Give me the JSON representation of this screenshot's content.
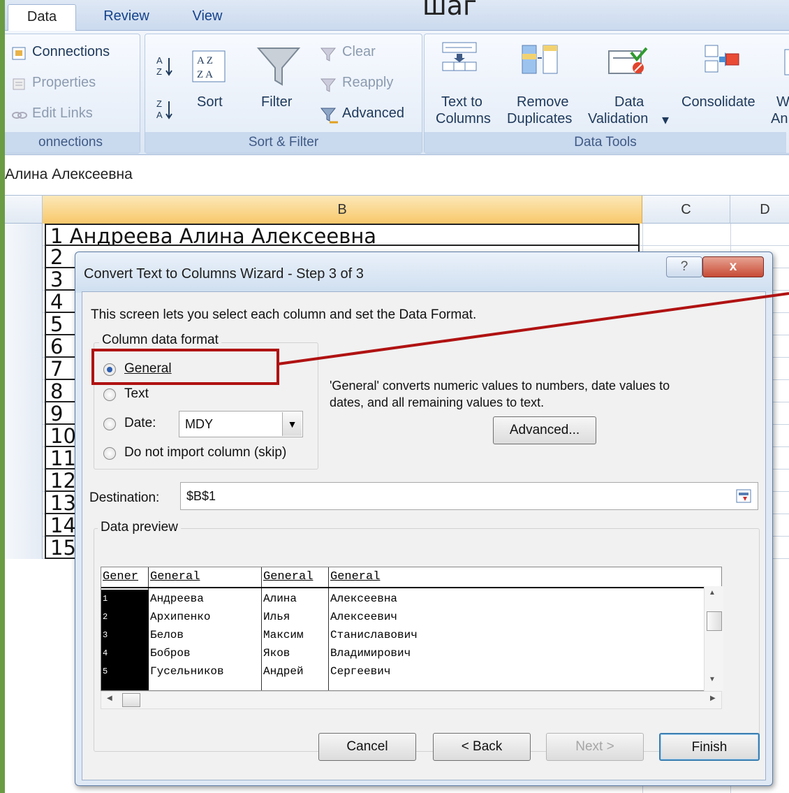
{
  "slide": {
    "title_fragment": "шаг"
  },
  "tabs": [
    {
      "label": "Data",
      "active": true
    },
    {
      "label": "Review",
      "active": false
    },
    {
      "label": "View",
      "active": false
    }
  ],
  "ribbon": {
    "connections": {
      "items": [
        "Connections",
        "Properties",
        "Edit Links"
      ],
      "label": "onnections"
    },
    "sort_filter": {
      "sort_label": "Sort",
      "filter_label": "Filter",
      "clear_label": "Clear",
      "reapply_label": "Reapply",
      "advanced_label": "Advanced",
      "label": "Sort & Filter"
    },
    "data_tools": {
      "text_to_columns": [
        "Text to",
        "Columns"
      ],
      "remove_duplicates": [
        "Remove",
        "Duplicates"
      ],
      "data_validation": [
        "Data",
        "Validation"
      ],
      "consolidate": "Consolidate",
      "whatif": [
        "W",
        "An"
      ],
      "label": "Data Tools"
    }
  },
  "formula_bar": {
    "value": "Алина Алексеевна"
  },
  "grid": {
    "columns": [
      "B",
      "C",
      "D"
    ],
    "first_row_text": "1 Андреева Алина Алексеевна",
    "row_prefixes": [
      "2 ",
      "3 ",
      "4 ",
      "5 ",
      "6 ",
      "7 ",
      "8 ",
      "9 ",
      "10",
      "11",
      "12",
      "13",
      "14",
      "15"
    ]
  },
  "dialog": {
    "title": "Convert Text to Columns Wizard - Step 3 of 3",
    "help": "?",
    "close": "x",
    "intro": "This screen lets you select each column and set the Data Format.",
    "format_legend": "Column data format",
    "options": [
      {
        "label": "General",
        "selected": true
      },
      {
        "label": "Text",
        "selected": false
      },
      {
        "label": "Date:",
        "selected": false
      },
      {
        "label": "Do not import column (skip)",
        "selected": false
      }
    ],
    "date_format": "MDY",
    "general_note_1": "'General' converts numeric values to numbers, date values to",
    "general_note_2": "dates, and all remaining values to text.",
    "advanced_button": "Advanced...",
    "destination_label": "Destination:",
    "destination_value": "$B$1",
    "preview_legend": "Data preview",
    "preview_headers": [
      "Gener",
      "General",
      "General",
      "General"
    ],
    "preview_rows": [
      [
        "1",
        "Андреева",
        "Алина",
        "Алексеевна"
      ],
      [
        "2",
        "Архипенко",
        "Илья",
        "Алексеевич"
      ],
      [
        "3",
        "Белов",
        "Максим",
        "Станиславович"
      ],
      [
        "4",
        "Бобров",
        "Яков",
        "Владимирович"
      ],
      [
        "5",
        "Гусельников",
        "Андрей",
        "Сергеевич"
      ]
    ],
    "buttons": {
      "cancel": "Cancel",
      "back": "< Back",
      "next": "Next >",
      "finish": "Finish"
    }
  },
  "colors": {
    "accent_callout": "#b01212",
    "ribbon_text": "#1e395b",
    "selected_column": "#f8c86b"
  }
}
